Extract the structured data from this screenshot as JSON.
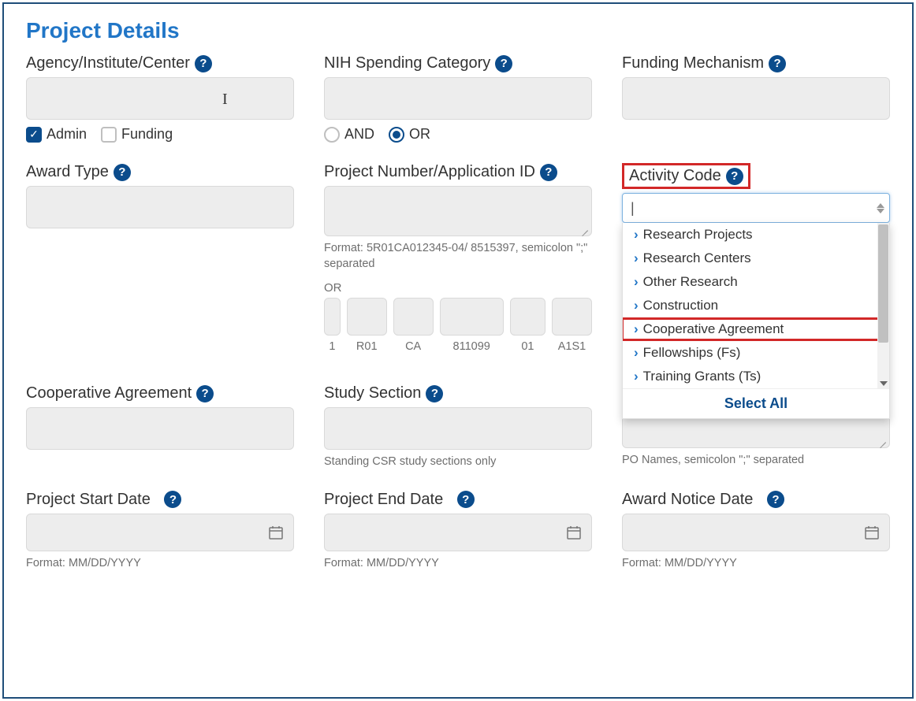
{
  "title": "Project Details",
  "fields": {
    "agency": {
      "label": "Agency/Institute/Center",
      "checkboxes": {
        "admin": {
          "label": "Admin",
          "checked": true
        },
        "funding": {
          "label": "Funding",
          "checked": false
        }
      }
    },
    "spending": {
      "label": "NIH Spending Category",
      "radios": {
        "and": {
          "label": "AND",
          "checked": false
        },
        "or": {
          "label": "OR",
          "checked": true
        }
      }
    },
    "funding_mechanism": {
      "label": "Funding Mechanism"
    },
    "award_type": {
      "label": "Award Type"
    },
    "project_number": {
      "label": "Project Number/Application ID",
      "hint": "Format: 5R01CA012345-04/ 8515397, semicolon \";\" separated",
      "or_label": "OR",
      "parts": {
        "p1": "1",
        "p2": "R01",
        "p3": "CA",
        "p4": "811099",
        "p5": "01",
        "p6": "A1S1"
      }
    },
    "activity_code": {
      "label": "Activity Code",
      "dropdown": {
        "items": {
          "i0": "Research Projects",
          "i1": "Research Centers",
          "i2": "Other Research",
          "i3": "Construction",
          "i4": "Cooperative Agreement",
          "i5": "Fellowships (Fs)",
          "i6": "Training Grants (Ts)"
        },
        "select_all": "Select All"
      }
    },
    "cooperative_agreement": {
      "label": "Cooperative Agreement"
    },
    "study_section": {
      "label": "Study Section",
      "hint": "Standing CSR study sections only"
    },
    "po_names": {
      "hint": "PO Names, semicolon \";\" separated"
    },
    "project_start": {
      "label": "Project Start Date",
      "hint": "Format: MM/DD/YYYY"
    },
    "project_end": {
      "label": "Project End Date",
      "hint": "Format: MM/DD/YYYY"
    },
    "award_notice": {
      "label": "Award Notice Date",
      "hint": "Format: MM/DD/YYYY"
    }
  }
}
